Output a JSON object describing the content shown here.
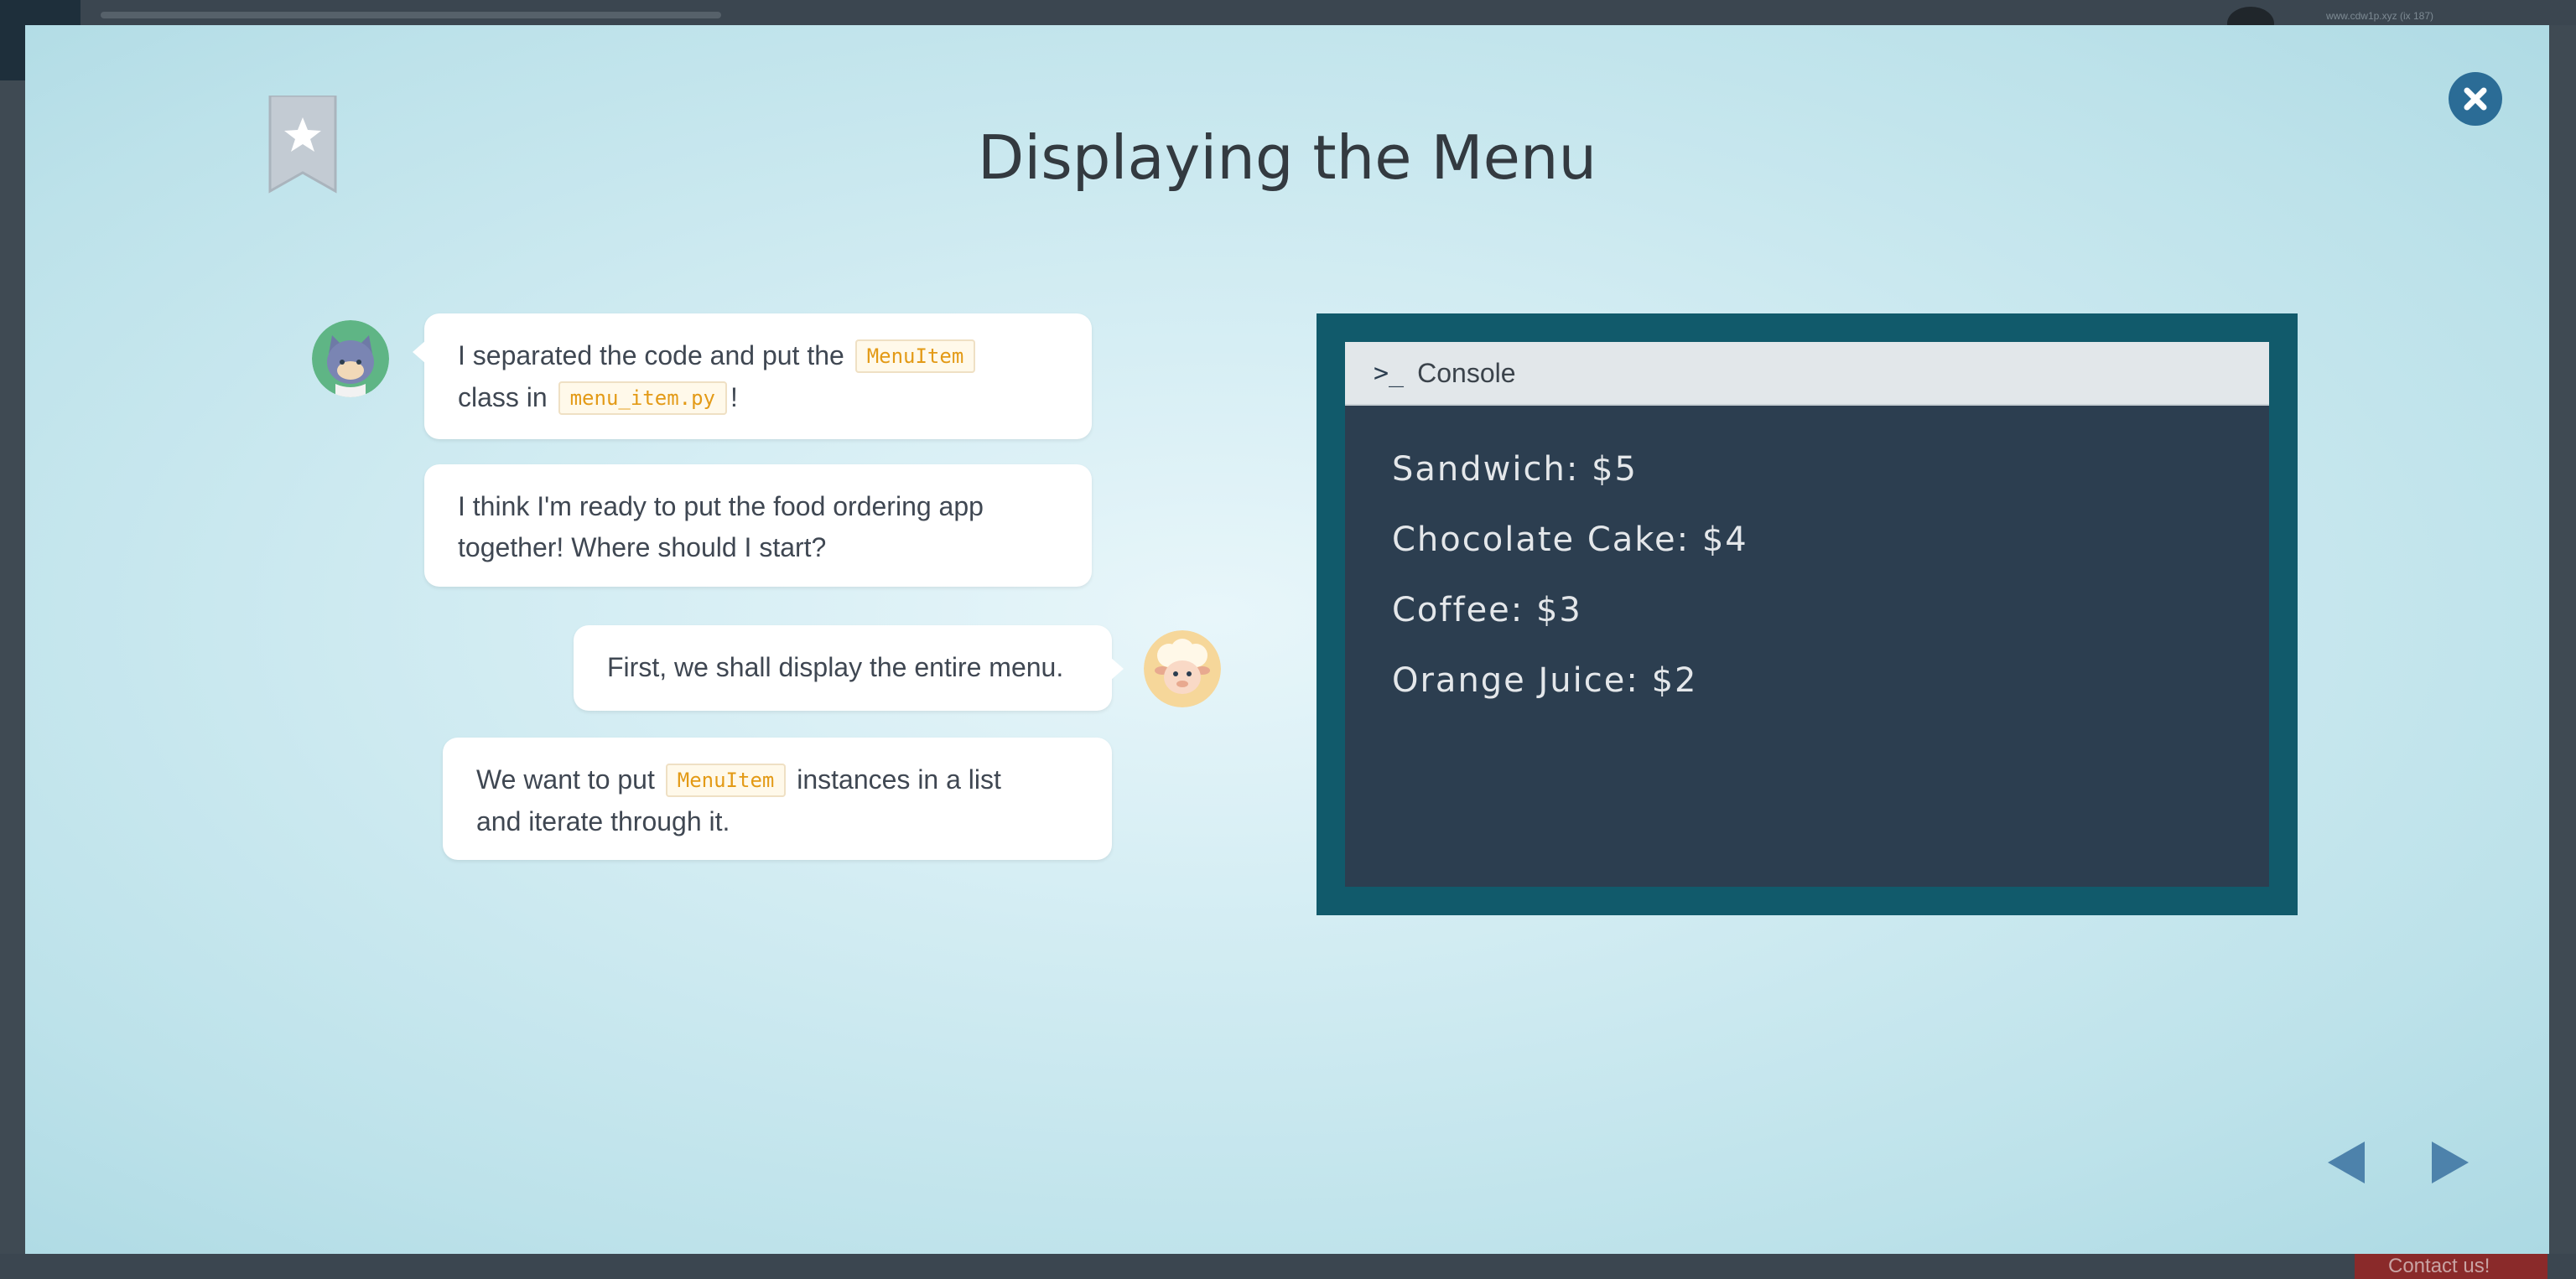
{
  "backdrop": {
    "email": "www.cdw1p.xyz (ix 187)",
    "contact_label": "Contact us!"
  },
  "modal": {
    "title": "Displaying the Menu",
    "bookmark_icon": "star-bookmark-icon",
    "close_icon": "close-icon"
  },
  "chat": {
    "messages": [
      {
        "speaker": "student",
        "parts": [
          "I separated the code and put the ",
          "MenuItem",
          "class in ",
          "menu_item.py",
          "!"
        ]
      },
      {
        "speaker": "student",
        "text_line1": "I think I'm ready to put the food ordering app",
        "text_line2": "together! Where should I start?"
      },
      {
        "speaker": "teacher",
        "text": "First, we shall display the entire menu."
      },
      {
        "speaker": "teacher",
        "parts": [
          "We want to put ",
          "MenuItem",
          " instances in a list",
          "and iterate through it."
        ]
      }
    ]
  },
  "console": {
    "header_icon": ">_",
    "title": "Console",
    "lines": [
      "Sandwich: $5",
      "Chocolate Cake: $4",
      "Coffee: $3",
      "Orange Juice: $2"
    ]
  },
  "colors": {
    "console_frame": "#115a6b",
    "console_bg": "#2c3e50",
    "code_text": "#e39a16",
    "nav_arrow": "#4d82ab",
    "close_button": "#2b6c96"
  }
}
